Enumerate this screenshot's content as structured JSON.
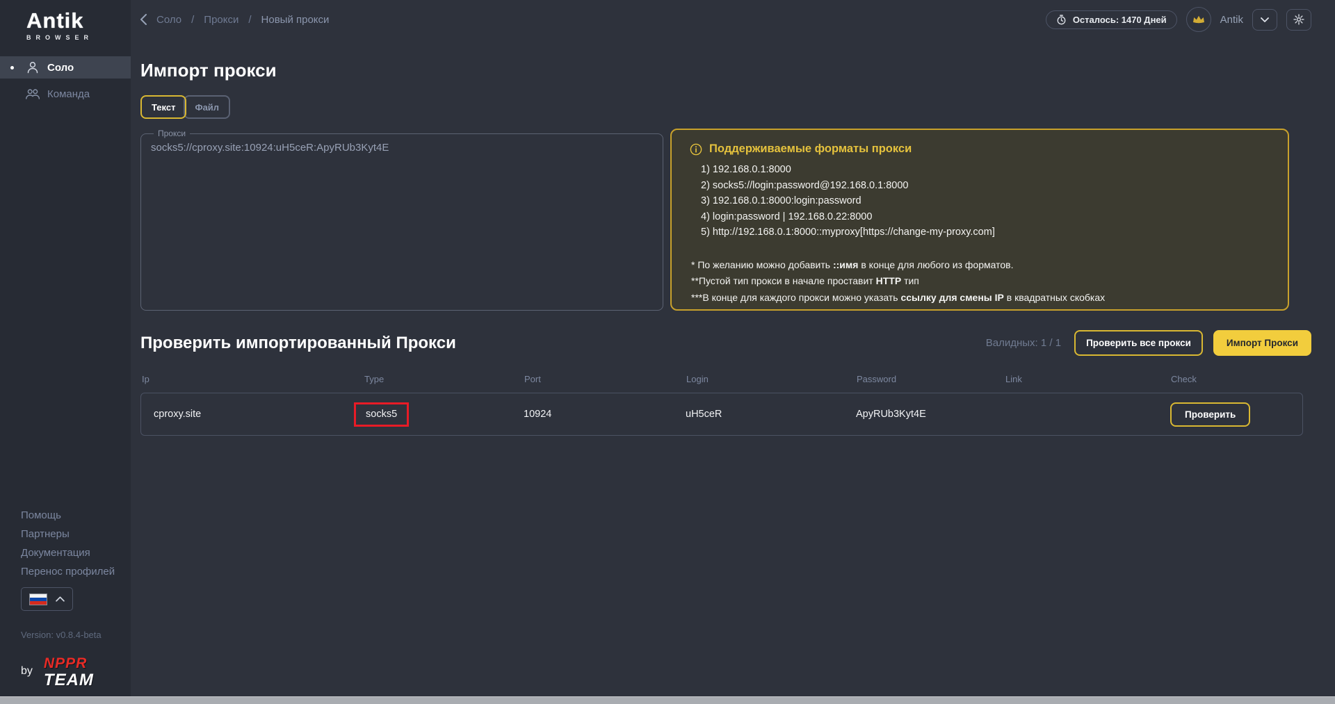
{
  "brand": {
    "logo_text": "Antik",
    "logo_sub": "BROWSER"
  },
  "topbar": {
    "breadcrumb": {
      "separator": "/",
      "items": [
        "Соло",
        "Прокси",
        "Новый прокси"
      ]
    },
    "remaining": "Осталось: 1470 Дней",
    "user_name": "Antik"
  },
  "sidebar": {
    "nav": [
      {
        "label": "Соло"
      },
      {
        "label": "Команда"
      }
    ],
    "links": [
      "Помощь",
      "Партнеры",
      "Документация",
      "Перенос профилей"
    ],
    "version": "Version: v0.8.4-beta",
    "by_label": "by",
    "team_line1": "NPPR",
    "team_line2": "TEAM"
  },
  "import_section": {
    "title": "Импорт прокси",
    "tabs": [
      {
        "label": "Текст"
      },
      {
        "label": "Файл"
      }
    ],
    "proxy_field": {
      "label": "Прокси",
      "value": "socks5://cproxy.site:10924:uH5ceR:ApyRUb3Kyt4E"
    },
    "formats": {
      "title": "Поддерживаемые форматы прокси",
      "items": [
        "1) 192.168.0.1:8000",
        "2) socks5://login:password@192.168.0.1:8000",
        "3) 192.168.0.1:8000:login:password",
        "4) login:password | 192.168.0.22:8000",
        "5) http://192.168.0.1:8000::myproxy[https://change-my-proxy.com]"
      ],
      "notes": [
        {
          "pre": "* По желанию можно добавить ",
          "bold": "::имя",
          "post": " в конце для любого из форматов."
        },
        {
          "pre": "**Пустой тип прокси в начале проставит ",
          "bold": "HTTP",
          "post": " тип"
        },
        {
          "pre": "***В конце для каждого прокси можно указать ",
          "bold": "ссылку для смены IP",
          "post": " в квадратных скобках"
        }
      ]
    }
  },
  "check_section": {
    "title": "Проверить импортированный Прокси",
    "valid_counter": "Валидных: 1 / 1",
    "check_all_button": "Проверить все прокси",
    "import_button": "Импорт Прокси",
    "table": {
      "headers": [
        "Ip",
        "Type",
        "Port",
        "Login",
        "Password",
        "Link",
        "Check"
      ],
      "row": {
        "ip": "cproxy.site",
        "type": "socks5",
        "port": "10924",
        "login": "uH5ceR",
        "password": "ApyRUb3Kyt4E",
        "link": "",
        "check_button": "Проверить"
      }
    }
  },
  "colors": {
    "accent_yellow": "#f2cd3d",
    "gold_border": "#c8a12b",
    "annotation_red": "#e81b26",
    "background": "#2e323c",
    "sidebar_background": "#272b34"
  }
}
